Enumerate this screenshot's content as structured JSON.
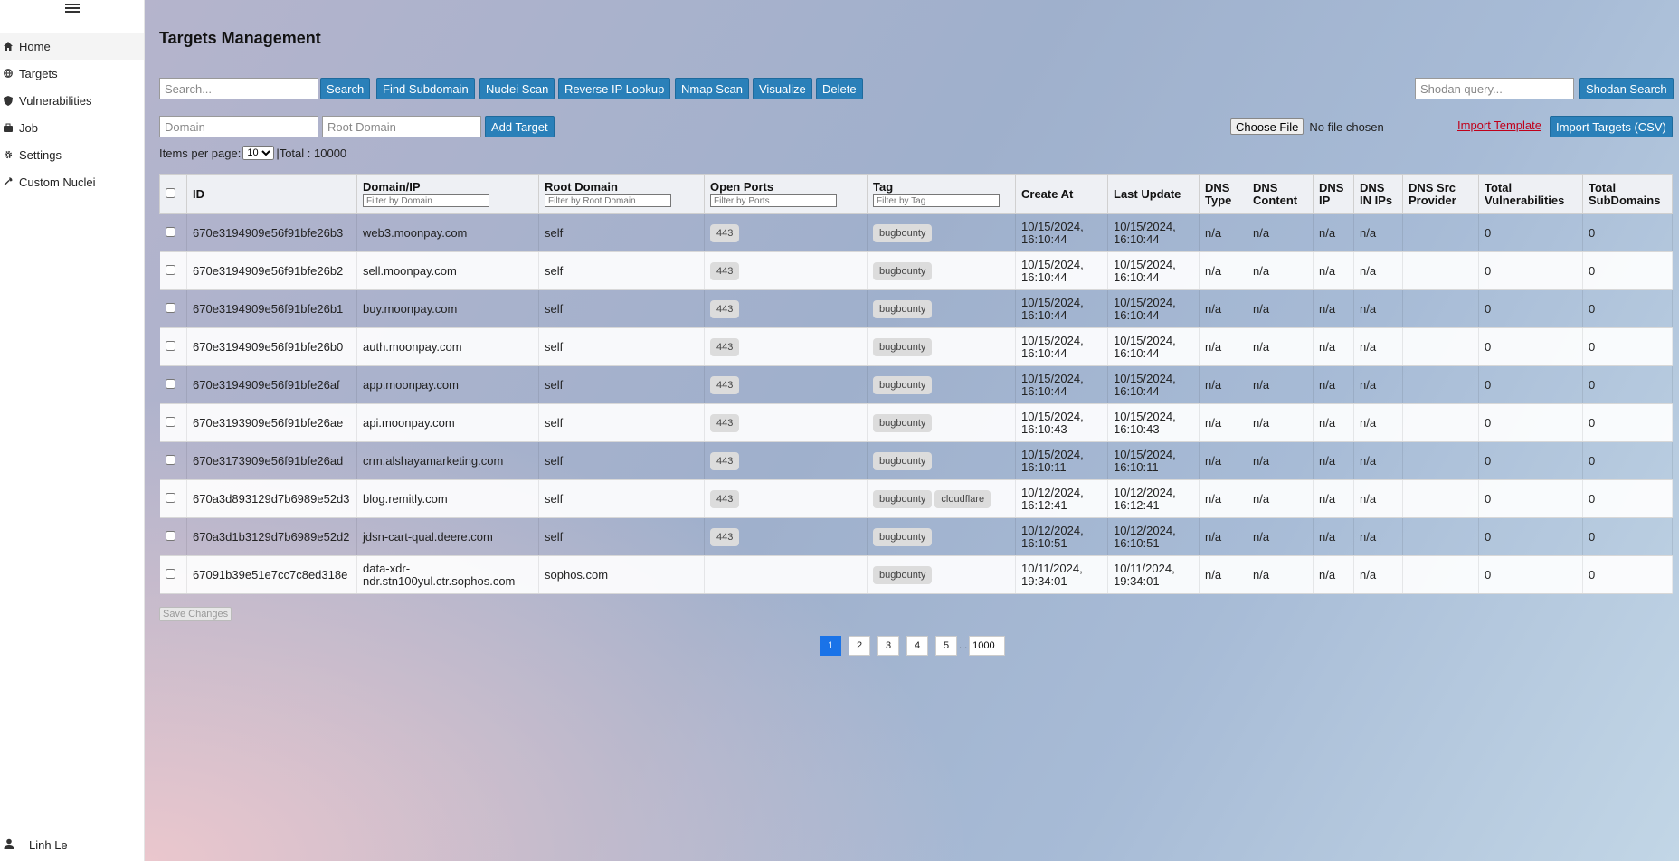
{
  "sidebar": {
    "items": [
      {
        "label": "Home",
        "icon": "home-icon"
      },
      {
        "label": "Targets",
        "icon": "globe-icon"
      },
      {
        "label": "Vulnerabilities",
        "icon": "shield-icon"
      },
      {
        "label": "Job",
        "icon": "briefcase-icon"
      },
      {
        "label": "Settings",
        "icon": "gear-icon"
      },
      {
        "label": "Custom Nuclei",
        "icon": "wrench-icon"
      }
    ],
    "user": "Linh Le"
  },
  "page": {
    "title": "Targets Management"
  },
  "toolbar": {
    "search_placeholder": "Search...",
    "search": "Search",
    "find_subdomain": "Find Subdomain",
    "nuclei_scan": "Nuclei Scan",
    "reverse_ip": "Reverse IP Lookup",
    "nmap_scan": "Nmap Scan",
    "visualize": "Visualize",
    "delete": "Delete",
    "shodan_placeholder": "Shodan query...",
    "shodan_search": "Shodan Search"
  },
  "add_form": {
    "domain_placeholder": "Domain",
    "root_domain_placeholder": "Root Domain",
    "add_target": "Add Target",
    "choose_file": "Choose File",
    "no_file": "No file chosen",
    "import_template": "Import Template",
    "import_targets": "Import Targets (CSV)"
  },
  "paging": {
    "items_per_page_label": "Items per page:",
    "items_per_page": "10",
    "total": "|Total : 10000",
    "pages": [
      "1",
      "2",
      "3",
      "4",
      "5"
    ],
    "dots": "...",
    "last_page": "1000"
  },
  "table": {
    "headers": {
      "id": "ID",
      "domain": "Domain/IP",
      "root": "Root Domain",
      "ports": "Open Ports",
      "tag": "Tag",
      "create": "Create At",
      "update": "Last Update",
      "dns_type": "DNS Type",
      "dns_content": "DNS Content",
      "dns_ip": "DNS IP",
      "dns_in_ips": "DNS IN IPs",
      "dns_src": "DNS Src Provider",
      "total_vuln": "Total Vulnerabilities",
      "total_sub": "Total SubDomains"
    },
    "filters": {
      "domain": "Filter by Domain",
      "root": "Filter by Root Domain",
      "ports": "Filter by Ports",
      "tag": "Filter by Tag"
    },
    "rows": [
      {
        "id": "670e3194909e56f91bfe26b3",
        "domain": "web3.moonpay.com",
        "root": "self",
        "ports": [
          "443"
        ],
        "tags": [
          "bugbounty"
        ],
        "create": "10/15/2024, 16:10:44",
        "update": "10/15/2024, 16:10:44",
        "dns_type": "n/a",
        "dns_content": "n/a",
        "dns_ip": "n/a",
        "dns_in_ips": "n/a",
        "dns_src": "",
        "vulns": "0",
        "subs": "0"
      },
      {
        "id": "670e3194909e56f91bfe26b2",
        "domain": "sell.moonpay.com",
        "root": "self",
        "ports": [
          "443"
        ],
        "tags": [
          "bugbounty"
        ],
        "create": "10/15/2024, 16:10:44",
        "update": "10/15/2024, 16:10:44",
        "dns_type": "n/a",
        "dns_content": "n/a",
        "dns_ip": "n/a",
        "dns_in_ips": "n/a",
        "dns_src": "",
        "vulns": "0",
        "subs": "0"
      },
      {
        "id": "670e3194909e56f91bfe26b1",
        "domain": "buy.moonpay.com",
        "root": "self",
        "ports": [
          "443"
        ],
        "tags": [
          "bugbounty"
        ],
        "create": "10/15/2024, 16:10:44",
        "update": "10/15/2024, 16:10:44",
        "dns_type": "n/a",
        "dns_content": "n/a",
        "dns_ip": "n/a",
        "dns_in_ips": "n/a",
        "dns_src": "",
        "vulns": "0",
        "subs": "0"
      },
      {
        "id": "670e3194909e56f91bfe26b0",
        "domain": "auth.moonpay.com",
        "root": "self",
        "ports": [
          "443"
        ],
        "tags": [
          "bugbounty"
        ],
        "create": "10/15/2024, 16:10:44",
        "update": "10/15/2024, 16:10:44",
        "dns_type": "n/a",
        "dns_content": "n/a",
        "dns_ip": "n/a",
        "dns_in_ips": "n/a",
        "dns_src": "",
        "vulns": "0",
        "subs": "0"
      },
      {
        "id": "670e3194909e56f91bfe26af",
        "domain": "app.moonpay.com",
        "root": "self",
        "ports": [
          "443"
        ],
        "tags": [
          "bugbounty"
        ],
        "create": "10/15/2024, 16:10:44",
        "update": "10/15/2024, 16:10:44",
        "dns_type": "n/a",
        "dns_content": "n/a",
        "dns_ip": "n/a",
        "dns_in_ips": "n/a",
        "dns_src": "",
        "vulns": "0",
        "subs": "0"
      },
      {
        "id": "670e3193909e56f91bfe26ae",
        "domain": "api.moonpay.com",
        "root": "self",
        "ports": [
          "443"
        ],
        "tags": [
          "bugbounty"
        ],
        "create": "10/15/2024, 16:10:43",
        "update": "10/15/2024, 16:10:43",
        "dns_type": "n/a",
        "dns_content": "n/a",
        "dns_ip": "n/a",
        "dns_in_ips": "n/a",
        "dns_src": "",
        "vulns": "0",
        "subs": "0"
      },
      {
        "id": "670e3173909e56f91bfe26ad",
        "domain": "crm.alshayamarketing.com",
        "root": "self",
        "ports": [
          "443"
        ],
        "tags": [
          "bugbounty"
        ],
        "create": "10/15/2024, 16:10:11",
        "update": "10/15/2024, 16:10:11",
        "dns_type": "n/a",
        "dns_content": "n/a",
        "dns_ip": "n/a",
        "dns_in_ips": "n/a",
        "dns_src": "",
        "vulns": "0",
        "subs": "0"
      },
      {
        "id": "670a3d893129d7b6989e52d3",
        "domain": "blog.remitly.com",
        "root": "self",
        "ports": [
          "443"
        ],
        "tags": [
          "bugbounty",
          "cloudflare"
        ],
        "create": "10/12/2024, 16:12:41",
        "update": "10/12/2024, 16:12:41",
        "dns_type": "n/a",
        "dns_content": "n/a",
        "dns_ip": "n/a",
        "dns_in_ips": "n/a",
        "dns_src": "",
        "vulns": "0",
        "subs": "0"
      },
      {
        "id": "670a3d1b3129d7b6989e52d2",
        "domain": "jdsn-cart-qual.deere.com",
        "root": "self",
        "ports": [
          "443"
        ],
        "tags": [
          "bugbounty"
        ],
        "create": "10/12/2024, 16:10:51",
        "update": "10/12/2024, 16:10:51",
        "dns_type": "n/a",
        "dns_content": "n/a",
        "dns_ip": "n/a",
        "dns_in_ips": "n/a",
        "dns_src": "",
        "vulns": "0",
        "subs": "0"
      },
      {
        "id": "67091b39e51e7cc7c8ed318e",
        "domain": "data-xdr-ndr.stn100yul.ctr.sophos.com",
        "root": "sophos.com",
        "ports": [],
        "tags": [
          "bugbounty"
        ],
        "create": "10/11/2024, 19:34:01",
        "update": "10/11/2024, 19:34:01",
        "dns_type": "n/a",
        "dns_content": "n/a",
        "dns_ip": "n/a",
        "dns_in_ips": "n/a",
        "dns_src": "",
        "vulns": "0",
        "subs": "0"
      }
    ],
    "save_changes": "Save Changes"
  }
}
